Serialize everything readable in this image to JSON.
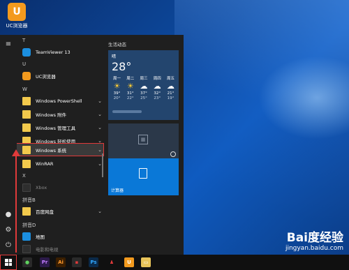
{
  "desktop": {
    "icon_label": "UC浏览器"
  },
  "start_menu": {
    "sections": {
      "t": "T",
      "u": "U",
      "w": "W",
      "x": "X",
      "pinyin_b": "拼音B",
      "pinyin_d": "拼音D"
    },
    "items": [
      {
        "label": "TeamViewer 13"
      },
      {
        "label": "UC浏览器"
      },
      {
        "label": "Windows PowerShell",
        "chevron": "⌄"
      },
      {
        "label": "Windows 附件",
        "chevron": "⌄"
      },
      {
        "label": "Windows 管理工具",
        "chevron": "⌄"
      },
      {
        "label": "Windows 轻松使用",
        "chevron": "⌄"
      },
      {
        "label": "Windows 系统",
        "chevron": "⌄"
      },
      {
        "label": "WinRAR",
        "chevron": "⌄"
      },
      {
        "label": "Xbox"
      },
      {
        "label": "百度网盘",
        "chevron": "⌄"
      },
      {
        "label": "地图"
      },
      {
        "label": "电影和电视"
      }
    ]
  },
  "tiles": {
    "group_title": "生活动态",
    "weather": {
      "condition": "晴",
      "temperature": "28°",
      "days": [
        {
          "name": "周一",
          "high": "39°",
          "low": "20°",
          "icon": "sun-icon"
        },
        {
          "name": "周二",
          "high": "31°",
          "low": "22°",
          "icon": "sun-icon"
        },
        {
          "name": "周三",
          "high": "37°",
          "low": "25°",
          "icon": "cloud-icon"
        },
        {
          "name": "周四",
          "high": "32°",
          "low": "23°",
          "icon": "cloud-rain-icon"
        },
        {
          "name": "周五",
          "high": "21°",
          "low": "19°",
          "icon": "cloud-rain-icon"
        }
      ]
    },
    "calculator_label": "计算器"
  },
  "watermark": {
    "logo": "Bai度经验",
    "url": "jingyan.baidu.com"
  },
  "colors": {
    "accent_red": "#e03a3a",
    "tile_blue": "#0a78d7"
  }
}
